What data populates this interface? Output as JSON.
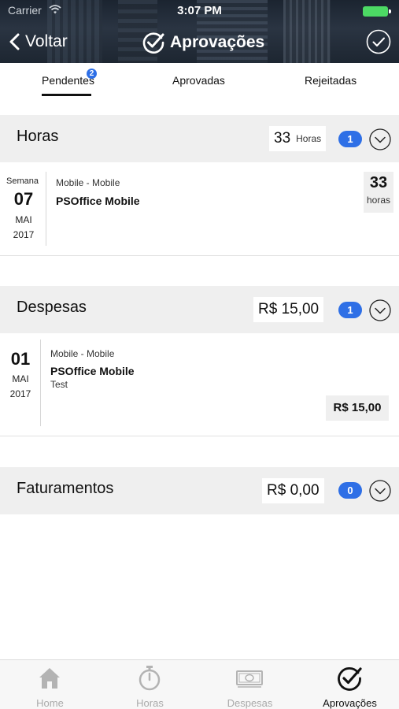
{
  "status_bar": {
    "carrier": "Carrier",
    "time": "3:07 PM"
  },
  "nav": {
    "back_label": "Voltar",
    "title": "Aprovações"
  },
  "tabs": [
    {
      "label": "Pendentes",
      "badge": "2",
      "active": true
    },
    {
      "label": "Aprovadas"
    },
    {
      "label": "Rejeitadas"
    }
  ],
  "sections": {
    "horas": {
      "title": "Horas",
      "total_value": "33",
      "total_unit": "Horas",
      "count": "1",
      "items": [
        {
          "week_label": "Semana",
          "day": "07",
          "month": "MAI",
          "year": "2017",
          "project": "Mobile - Mobile",
          "client": "PSOffice Mobile",
          "value": "33",
          "unit": "horas"
        }
      ]
    },
    "despesas": {
      "title": "Despesas",
      "total_value": "R$ 15,00",
      "count": "1",
      "items": [
        {
          "day": "01",
          "month": "MAI",
          "year": "2017",
          "project": "Mobile - Mobile",
          "client": "PSOffice Mobile",
          "description": "Test",
          "value": "R$ 15,00"
        }
      ]
    },
    "faturamentos": {
      "title": "Faturamentos",
      "total_value": "R$ 0,00",
      "count": "0"
    }
  },
  "tabbar": [
    {
      "label": "Home",
      "icon": "home-icon"
    },
    {
      "label": "Horas",
      "icon": "stopwatch-icon"
    },
    {
      "label": "Despesas",
      "icon": "banknote-icon"
    },
    {
      "label": "Aprovações",
      "icon": "check-circle-icon",
      "active": true
    }
  ],
  "colors": {
    "accent": "#2e6fe6",
    "band": "#efefef",
    "battery": "#4cd964"
  }
}
